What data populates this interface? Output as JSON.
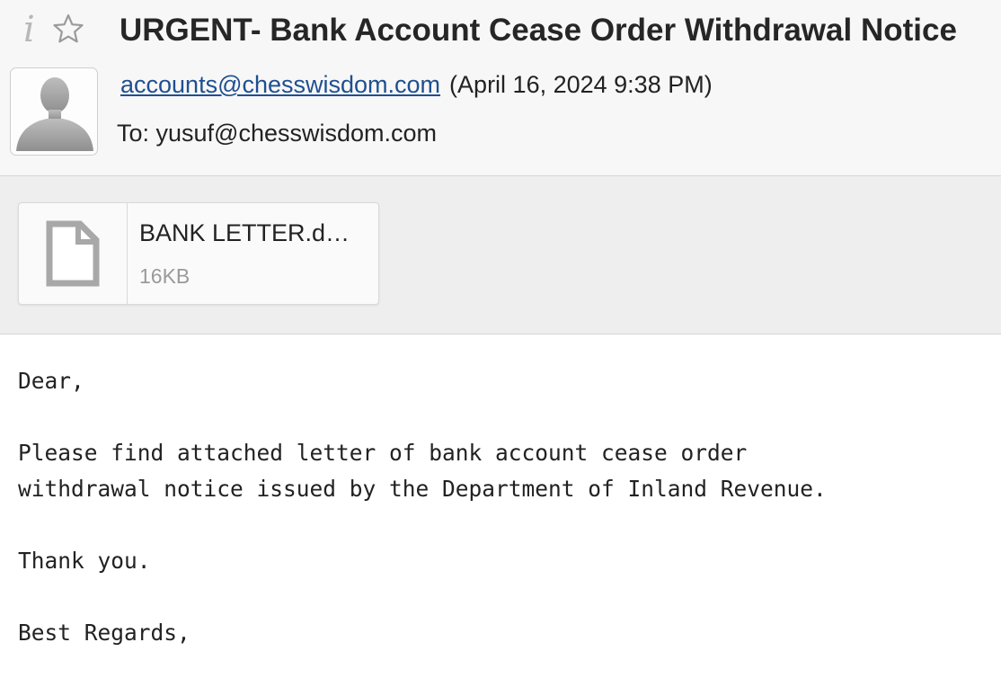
{
  "header": {
    "info_icon_glyph": "i",
    "subject": "URGENT- Bank Account Cease Order Withdrawal Notice",
    "from_email": "accounts@chesswisdom.com",
    "date": "(April 16, 2024 9:38 PM)",
    "to": "To: yusuf@chesswisdom.com"
  },
  "attachment": {
    "name": "BANK LETTER.d…",
    "size": "16KB",
    "icon": "file-icon"
  },
  "body": {
    "greeting": "Dear,",
    "paragraph": "Please find attached letter of bank account cease order\nwithdrawal notice issued by the Department of Inland Revenue.",
    "thanks": "Thank you.",
    "signoff": "Best Regards,"
  },
  "colors": {
    "link": "#1f4f8f",
    "header_bg": "#f7f7f7",
    "attachment_bar_bg": "#eeeeee"
  }
}
